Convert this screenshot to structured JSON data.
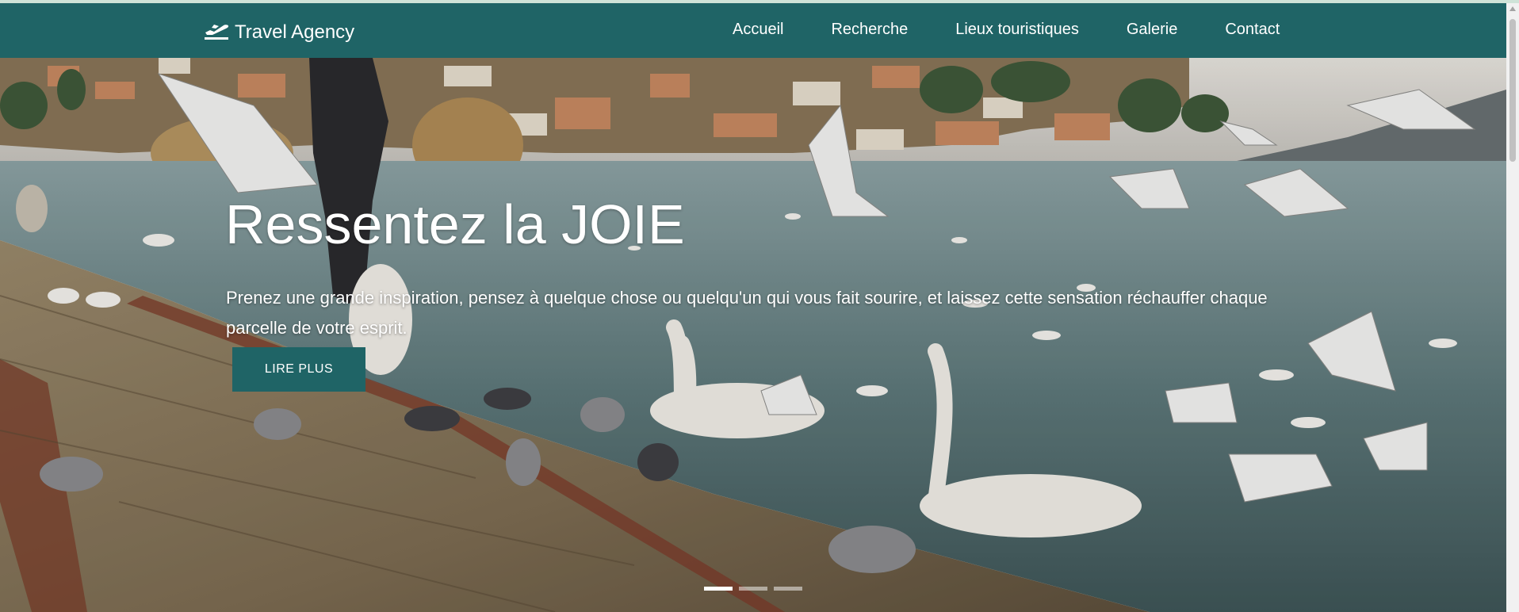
{
  "navbar": {
    "brand": "Travel Agency",
    "brand_icon": "plane-departure-icon",
    "links": [
      "Accueil",
      "Recherche",
      "Lieux touristiques",
      "Galerie",
      "Contact"
    ],
    "bg_color": "#1f6466"
  },
  "hero": {
    "title": "Ressentez la JOIE",
    "text": "Prenez une grande inspiration, pensez à quelque chose ou quelqu'un qui vous fait sourire, et laissez cette sensation réchauffer chaque parcelle de votre esprit.",
    "button_label": "LIRE PLUS",
    "slides_total": 3,
    "active_slide": 1
  }
}
